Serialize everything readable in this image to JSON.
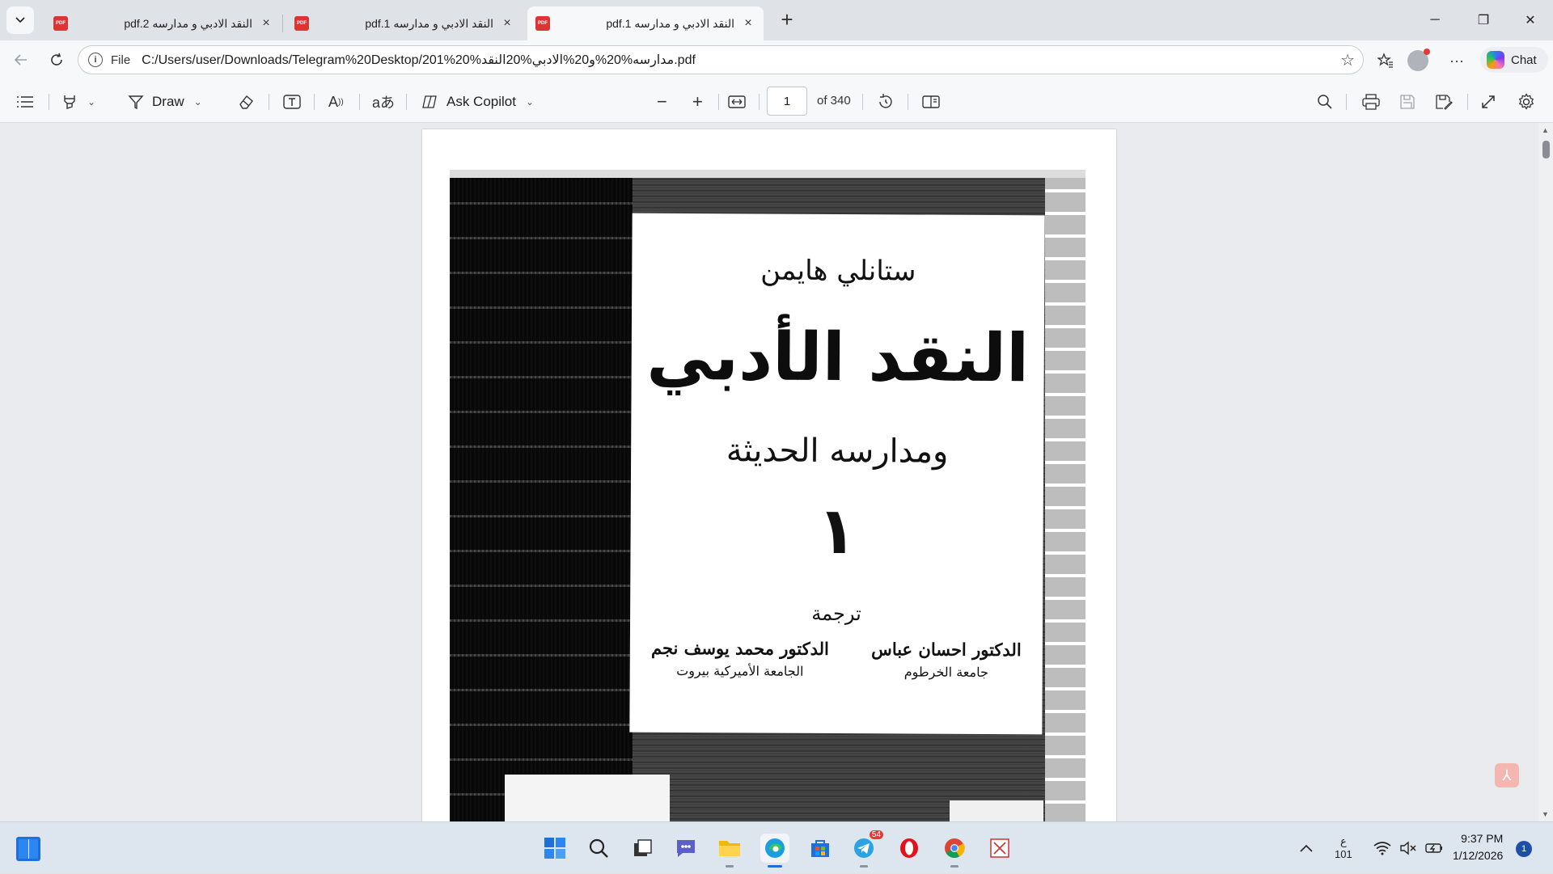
{
  "tabs": [
    {
      "title": "النقد الادبي و مدارسه pdf.2",
      "close": "×",
      "icon": "pdf-icon"
    },
    {
      "title": "النقد الادبي و مدارسه pdf.1",
      "close": "×",
      "icon": "pdf-icon"
    },
    {
      "title": "النقد الادبي و مدارسه pdf.1",
      "close": "×",
      "icon": "pdf-icon"
    }
  ],
  "window_controls": {
    "minimize": "─",
    "restore": "❐",
    "close": "✕"
  },
  "address": {
    "scheme": "File",
    "url": "C:/Users/user/Downloads/Telegram%20Desktop/201%20%مدارسه%20%و20%الادبي%20النقد.pdf"
  },
  "chat": {
    "label": "Chat"
  },
  "pdf_toolbar": {
    "draw_label": "Draw",
    "ask_copilot_label": "Ask Copilot",
    "page_number": "1",
    "page_count": "of 340"
  },
  "cover": {
    "author": "ستانلي هايمن",
    "title": "النقد الأدبي",
    "subtitle": "ومدارسه الحديثة",
    "volume": "١",
    "translation_label": "ترجمة",
    "translators": [
      {
        "name": "الدكتور احسان عباس",
        "affiliation": "جامعة الخرطوم"
      },
      {
        "name": "الدكتور محمد يوسف نجم",
        "affiliation": "الجامعة الأميركية بيروت"
      }
    ]
  },
  "taskbar": {
    "telegram_badge": "54",
    "lang_top": "ع",
    "lang_bottom": "101",
    "time": "9:37 PM",
    "date": "1/12/2026",
    "notification_count": "1"
  },
  "colors": {
    "accent": "#1e6fd9",
    "pdf_red": "#d33333",
    "toolbar_bg": "#f7f8fa"
  }
}
